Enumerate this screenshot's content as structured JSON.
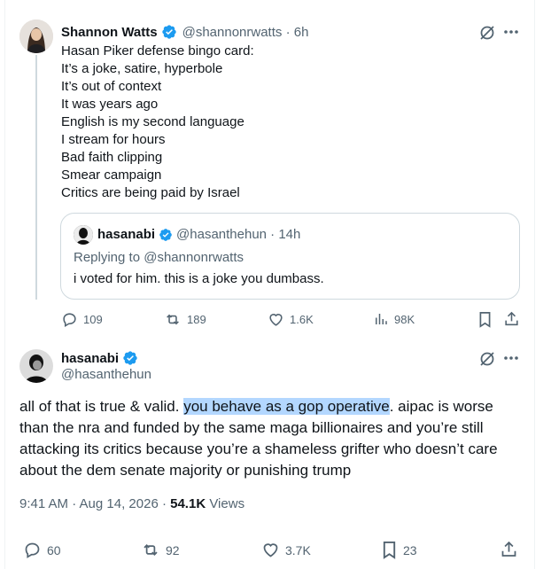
{
  "colors": {
    "verified": "#1d9bf0",
    "text": "#0f1419",
    "muted": "#536471",
    "highlight": "#b3d7ff"
  },
  "tweet1": {
    "display_name": "Shannon Watts",
    "handle_time": "@shannonrwatts · 6h",
    "lines": [
      "Hasan Piker defense bingo card:",
      "It’s a joke, satire, hyperbole",
      "It’s out of context",
      "It was years ago",
      "English is my second language",
      "I stream for hours",
      "Bad faith clipping",
      "Smear campaign",
      "Critics are being paid by Israel"
    ],
    "quote": {
      "display_name": "hasanabi",
      "handle_time": "@hasanthehun · 14h",
      "replying": "Replying to @shannonrwatts",
      "text": "i voted for him. this is a joke you dumbass."
    },
    "actions": {
      "replies": "109",
      "reposts": "189",
      "likes": "1.6K",
      "views": "98K"
    }
  },
  "tweet2": {
    "display_name": "hasanabi",
    "handle": "@hasanthehun",
    "text_before": "all of that is true & valid. ",
    "text_highlight": "you behave as a gop operative",
    "text_l1_after": ". aipac is worse",
    "text_l2": "than the nra and funded by the same maga billionaires and you’re still",
    "text_l3": "attacking its critics because you’re a shameless grifter who doesn’t care",
    "text_l4": "about the dem senate majority or punishing trump",
    "timestamp": "9:41 AM · Aug 14, 2026 · ",
    "views_count": "54.1K",
    "views_label": " Views",
    "actions": {
      "replies": "60",
      "reposts": "92",
      "likes": "3.7K",
      "bookmarks": "23"
    }
  }
}
